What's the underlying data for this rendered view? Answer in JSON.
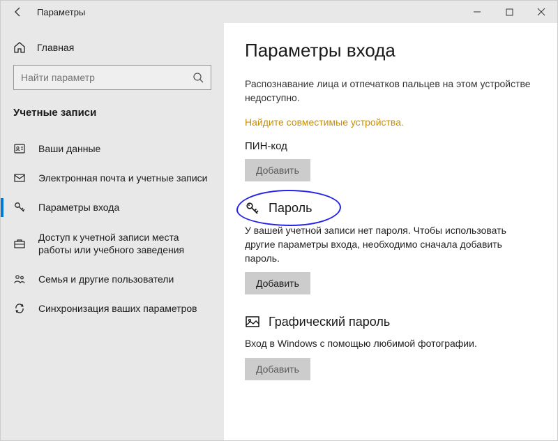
{
  "window": {
    "title": "Параметры"
  },
  "sidebar": {
    "home_label": "Главная",
    "search_placeholder": "Найти параметр",
    "section_label": "Учетные записи",
    "items": [
      {
        "label": "Ваши данные"
      },
      {
        "label": "Электронная почта и учетные записи"
      },
      {
        "label": "Параметры входа"
      },
      {
        "label": "Доступ к учетной записи места работы или учебного заведения"
      },
      {
        "label": "Семья и другие пользователи"
      },
      {
        "label": "Синхронизация ваших параметров"
      }
    ]
  },
  "main": {
    "heading": "Параметры входа",
    "unavailable_text": "Распознавание лица и отпечатков пальцев на этом устройстве недоступно.",
    "find_devices_link": "Найдите совместимые устройства.",
    "pin": {
      "title": "ПИН-код",
      "button": "Добавить"
    },
    "password": {
      "title": "Пароль",
      "description": "У вашей учетной записи нет пароля. Чтобы использовать другие параметры входа, необходимо сначала добавить пароль.",
      "button": "Добавить"
    },
    "picture_password": {
      "title": "Графический пароль",
      "description": "Вход в Windows с помощью любимой фотографии.",
      "button": "Добавить"
    }
  }
}
